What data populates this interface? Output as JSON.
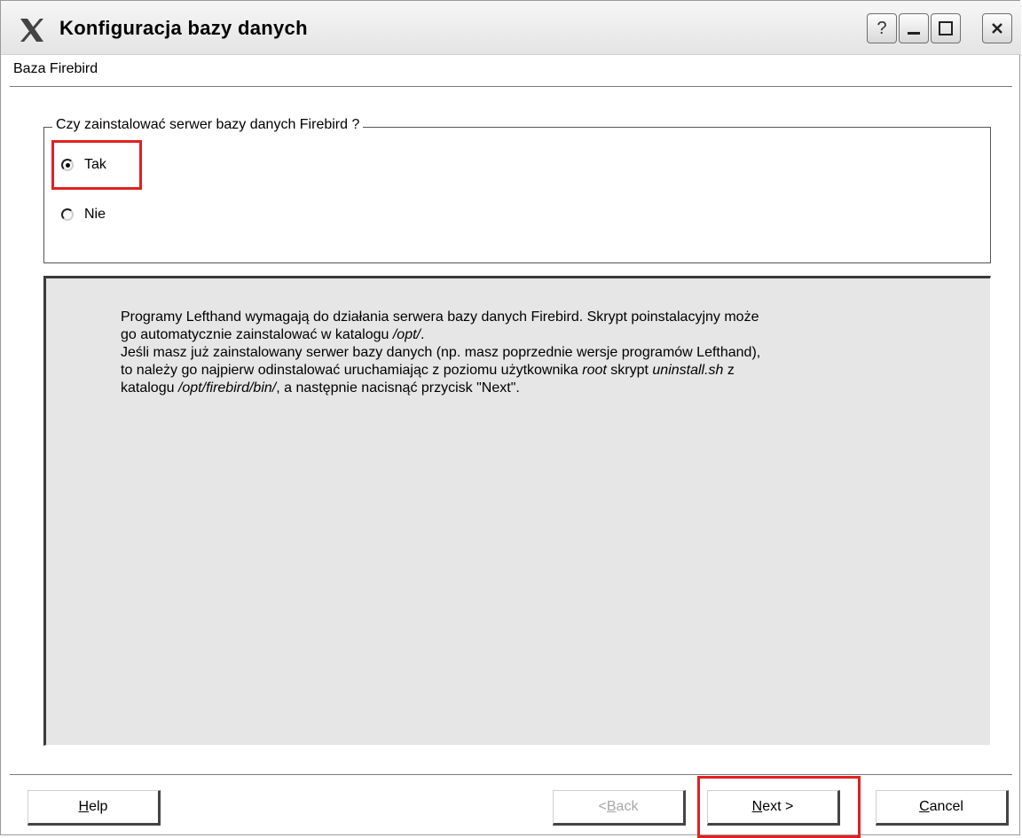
{
  "window": {
    "title": "Konfiguracja bazy danych",
    "subtitle": "Baza Firebird",
    "titlebar_buttons": {
      "help": "?"
    }
  },
  "group": {
    "legend": "Czy zainstalować serwer bazy danych Firebird ?",
    "options": [
      {
        "label": "Tak",
        "checked": true
      },
      {
        "label": "Nie",
        "checked": false
      }
    ]
  },
  "info": {
    "line1": " Programy Lefthand wymagają do działania serwera bazy danych Firebird. Skrypt poinstalacyjny może",
    "line2_pre": "go automatycznie zainstalować w katalogu ",
    "line2_path": "/opt/",
    "line2_post": ".",
    "line3": " Jeśli masz już zainstalowany serwer bazy danych (np. masz poprzednie wersje programów Lefthand),",
    "line4_pre": "to należy go najpierw odinstalować uruchamiając z poziomu użytkownika ",
    "line4_user": "root",
    "line4_mid": " skrypt ",
    "line4_script": "uninstall.sh",
    "line4_post": " z",
    "line5_pre": "katalogu ",
    "line5_path": "/opt/firebird/bin/",
    "line5_post": ", a następnie nacisnąć przycisk \"Next\"."
  },
  "buttons": {
    "help_hot": "H",
    "help_rest": "elp",
    "back_pre": "< ",
    "back_hot": "B",
    "back_rest": "ack",
    "next_hot": "N",
    "next_rest": "ext >",
    "cancel_hot": "C",
    "cancel_rest": "ancel"
  },
  "colors": {
    "highlight": "#e02020",
    "panel": "#e6e6e6"
  }
}
